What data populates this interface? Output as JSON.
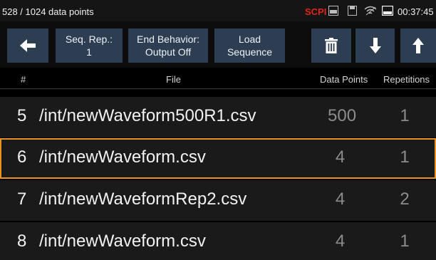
{
  "status": {
    "points_info": "528 / 1024 data points",
    "scpi": "SCPI",
    "time": "00:37:45",
    "icons": [
      "log-icon",
      "storage-icon",
      "wifi-icon",
      "usb-icon"
    ]
  },
  "toolbar": {
    "back_icon": "arrow-left-icon",
    "seq_rep_label": "Seq. Rep.:\n1",
    "end_behavior_label": "End Behavior:\nOutput Off",
    "load_sequence_label": "Load\nSequence",
    "delete_icon": "trash-icon",
    "move_down_icon": "arrow-down-icon",
    "move_up_icon": "arrow-up-icon"
  },
  "table": {
    "columns": [
      "#",
      "File",
      "Data Points",
      "Repetitions"
    ],
    "rows": [
      {
        "index": "5",
        "file": "/int/newWaveform500R1.csv",
        "points": "500",
        "reps": "1"
      },
      {
        "index": "6",
        "file": "/int/newWaveform.csv",
        "points": "4",
        "reps": "1"
      },
      {
        "index": "7",
        "file": "/int/newWaveformRep2.csv",
        "points": "4",
        "reps": "2"
      },
      {
        "index": "8",
        "file": "/int/newWaveform.csv",
        "points": "4",
        "reps": "1"
      }
    ]
  },
  "colors": {
    "accent": "#e8941f",
    "button": "#2d3e52",
    "scpi": "#e0261a"
  }
}
